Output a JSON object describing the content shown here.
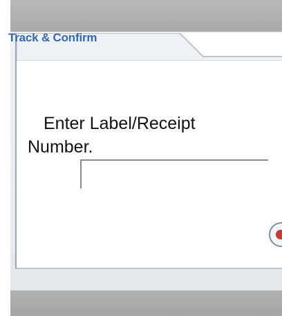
{
  "tab": {
    "title": "Track & Confirm"
  },
  "prompt": {
    "line1": "Enter Label/Receipt",
    "line2": "Number."
  },
  "input": {
    "value": ""
  },
  "go_button": {
    "icon": "go-icon"
  },
  "colors": {
    "accent": "#3369b2",
    "frame": "#e4e8ec",
    "bar": "#a9a9a9",
    "button_icon": "#c63b2f"
  }
}
